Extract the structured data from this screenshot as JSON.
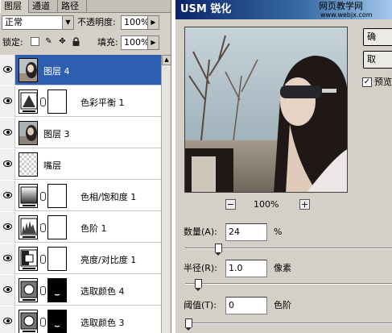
{
  "layers_panel": {
    "tabs": [
      {
        "label": "图层"
      },
      {
        "label": "通道"
      },
      {
        "label": "路径"
      }
    ],
    "blend_mode": "正常",
    "opacity_label": "不透明度:",
    "opacity_value": "100%",
    "lock_label": "锁定:",
    "fill_label": "填充:",
    "fill_value": "100%",
    "layers": [
      {
        "name": "图层 4",
        "selected": true,
        "thumb": "photo"
      },
      {
        "name": "色彩平衡 1",
        "selected": false,
        "thumb": "color-balance"
      },
      {
        "name": "图层 3",
        "selected": false,
        "thumb": "photo"
      },
      {
        "name": "嘴层",
        "selected": false,
        "thumb": "transparent"
      },
      {
        "name": "色相/饱和度 1",
        "selected": false,
        "thumb": "hue-saturation"
      },
      {
        "name": "色阶 1",
        "selected": false,
        "thumb": "levels"
      },
      {
        "name": "亮度/对比度 1",
        "selected": false,
        "thumb": "brightness-contrast"
      },
      {
        "name": "选取颜色 4",
        "selected": false,
        "thumb": "selective-color"
      },
      {
        "name": "选取颜色 3",
        "selected": false,
        "thumb": "selective-color"
      }
    ]
  },
  "usm_dialog": {
    "title": "USM 锐化",
    "watermark_line1": "网页教学网",
    "watermark_line2": "www.webjx.com",
    "ok_button": "确",
    "reset_button": "取",
    "preview_label": "预览",
    "preview_checked": true,
    "zoom_level": "100%",
    "zoom_out_icon": "−",
    "zoom_in_icon": "+",
    "amount_label": "数量(A):",
    "amount_value": "24",
    "amount_unit": "%",
    "radius_label": "半径(R):",
    "radius_value": "1.0",
    "radius_unit": "像素",
    "threshold_label": "阈值(T):",
    "threshold_value": "0",
    "threshold_unit": "色阶"
  }
}
